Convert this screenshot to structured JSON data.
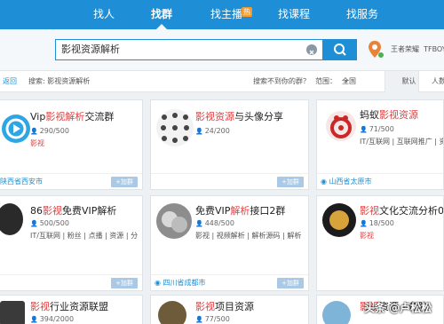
{
  "nav": {
    "tabs": [
      "找人",
      "找群",
      "找主播",
      "找课程",
      "找服务"
    ],
    "active_tab": "找群",
    "hot_badge": "热"
  },
  "search": {
    "value": "影视资源解析",
    "user_name": "王者荣耀",
    "user_id": "TFBOY"
  },
  "filter": {
    "back_label": "返回",
    "search_label": "搜索: 影视资源解析",
    "cannot_find": "搜索不到你的群？",
    "range_label": "范围：",
    "range_value": "全国",
    "sort_default": "默认",
    "sort_members": "人数"
  },
  "cards": [
    {
      "name_hl": "影视解析",
      "name_pre": "Vip",
      "name_post": "交流群",
      "count": "290/500",
      "tags": "影视",
      "tags_red": true,
      "location": "陕西省西安市",
      "join": "+加群"
    },
    {
      "name_hl": "影视资源",
      "name_pre": "",
      "name_post": "与头像分享",
      "count": "24/200",
      "tags": "",
      "tags_red": false,
      "location": "",
      "join": "+加群"
    },
    {
      "name_hl": "影视资源",
      "name_pre": "蚂蚁",
      "name_post": "",
      "count": "71/500",
      "tags": "IT/互联网 | 互联网推广 | 资源",
      "tags_red": false,
      "location": "山西省太原市",
      "join": "+加群"
    },
    {
      "name_hl": "影视",
      "name_pre": "86",
      "name_post": "免费VIP解析",
      "count": "500/500",
      "tags": "IT/互联网 | 粉丝 | 点播 | 资源 | 分",
      "tags_red": false,
      "location": "",
      "join": "+加群"
    },
    {
      "name_hl": "解析",
      "name_pre": "免费VIP",
      "name_post": "接口2群",
      "count": "448/500",
      "tags": "影视 | 视频解析 | 解析源码 | 解析",
      "tags_red": false,
      "location": "四川省成都市",
      "join": "+加群"
    },
    {
      "name_hl": "影视",
      "name_pre": "",
      "name_post": "文化交流分析03",
      "count": "18/500",
      "tags": "影视",
      "tags_red": true,
      "location": "",
      "join": "+加群"
    },
    {
      "name_hl": "影视",
      "name_pre": "",
      "name_post": "行业资源联盟",
      "count": "394/2000",
      "tags": "",
      "tags_red": false,
      "location": "",
      "join": ""
    },
    {
      "name_hl": "影视",
      "name_pre": "",
      "name_post": "项目资源",
      "count": "77/500",
      "tags": "",
      "tags_red": false,
      "location": "",
      "join": ""
    },
    {
      "name_hl": "影视",
      "name_pre": "",
      "name_post": "资源 - 备胎",
      "count": "",
      "tags": "",
      "tags_red": false,
      "location": "",
      "join": ""
    }
  ],
  "watermark": "头条 @卢松松",
  "colors": {
    "primary": "#1e8fd6",
    "highlight": "#e04040",
    "join": "#a9c9e6"
  }
}
